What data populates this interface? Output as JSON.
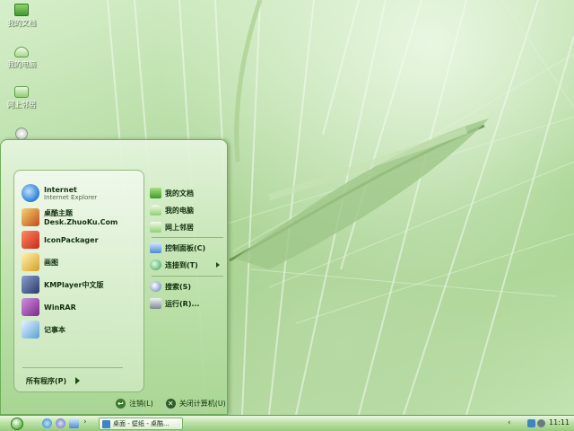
{
  "desktop": {
    "icons": [
      {
        "label": "我的文档",
        "icon": "my-documents-icon"
      },
      {
        "label": "我的电脑",
        "icon": "my-computer-icon"
      },
      {
        "label": "网上邻居",
        "icon": "network-places-icon"
      },
      {
        "label": "",
        "icon": "recycle-bin-icon"
      }
    ]
  },
  "start_menu": {
    "pinned": [
      {
        "title": "Internet",
        "subtitle": "Internet Explorer",
        "icon": "internet-explorer-icon",
        "color": "#2a7fd4"
      }
    ],
    "recent": [
      {
        "title": "桌酷主题Desk.ZhuoKu.Com",
        "icon": "zhuoku-icon",
        "color": "#c44a18"
      },
      {
        "title": "IconPackager",
        "icon": "iconpackager-icon",
        "color": "#c8281e"
      },
      {
        "title": "画图",
        "icon": "paint-icon",
        "color": "#d8a020"
      },
      {
        "title": "KMPlayer中文版",
        "icon": "kmplayer-icon",
        "color": "#2a3a6a"
      },
      {
        "title": "WinRAR",
        "icon": "winrar-icon",
        "color": "#7a2a8a"
      },
      {
        "title": "记事本",
        "icon": "notepad-icon",
        "color": "#5aa0d8"
      }
    ],
    "all_programs": "所有程序(P)",
    "places": [
      {
        "label": "我的文档",
        "icon": "my-documents-icon",
        "color": "#5db83e"
      },
      {
        "label": "我的电脑",
        "icon": "my-computer-icon",
        "color": "#8fcf72"
      },
      {
        "label": "网上邻居",
        "icon": "network-places-icon",
        "color": "#8fcf72"
      }
    ],
    "system": [
      {
        "label": "控制面板(C)",
        "icon": "control-panel-icon",
        "color": "#4a8ad0"
      },
      {
        "label": "连接到(T)",
        "icon": "connect-to-icon",
        "color": "#3a9a5a",
        "submenu": true
      }
    ],
    "tools": [
      {
        "label": "搜索(S)",
        "icon": "search-icon",
        "color": "#5a7ab8"
      },
      {
        "label": "运行(R)...",
        "icon": "run-icon",
        "color": "#7a8a90"
      }
    ],
    "logoff": "注销(L)",
    "shutdown": "关闭计算机(U)"
  },
  "taskbar": {
    "task_button": "桌面 - 壁纸 - 桌酷...",
    "clock": "11:11"
  },
  "colors": {
    "accent": "#5e9c48",
    "text_dark": "#12300d"
  }
}
